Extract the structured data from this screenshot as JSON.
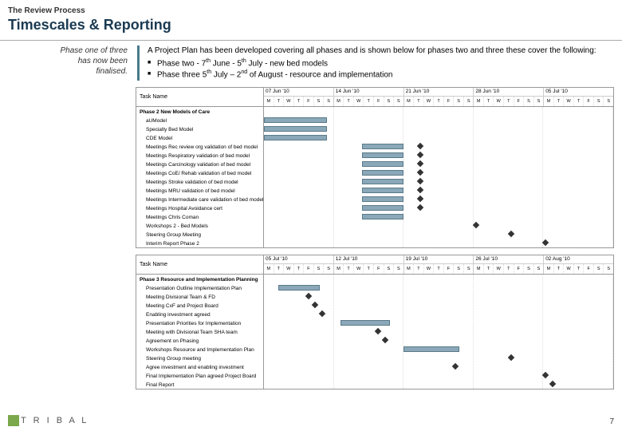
{
  "header": {
    "review_process": "The Review Process",
    "title": "Timescales & Reporting"
  },
  "phase_note": {
    "line1": "Phase one of three",
    "line2": "has now been",
    "line3": "finalised."
  },
  "intro": {
    "lead": "A Project Plan has been developed covering all phases and is shown below for phases two and three these cover the following:",
    "bullet1_a": "Phase two - 7",
    "bullet1_b": " June - 5",
    "bullet1_c": " July - new bed models",
    "bullet2_a": "Phase three 5",
    "bullet2_b": " July – 2",
    "bullet2_c": " of August - resource and implementation",
    "th": "th",
    "nd": "nd"
  },
  "gantt1": {
    "task_header": "Task Name",
    "weeks": [
      "07 Jun '10",
      "14 Jun '10",
      "21 Jun '10",
      "28 Jun '10",
      "05 Jul '10"
    ],
    "days": [
      "M",
      "T",
      "W",
      "T",
      "F",
      "S",
      "S"
    ],
    "rows": [
      {
        "label": "Phase 2 New Models of Care",
        "bold": true,
        "indent": false
      },
      {
        "label": "aUModel",
        "indent": true
      },
      {
        "label": "Specialty Bed Model",
        "indent": true
      },
      {
        "label": "CDE Model",
        "indent": true
      },
      {
        "label": "Meetings Rec review org validation of bed model",
        "indent": true
      },
      {
        "label": "Meetings Respiratory validation of bed model",
        "indent": true
      },
      {
        "label": "Meetings Carcinology validation of bed model",
        "indent": true
      },
      {
        "label": "Meetings CoE/ Rehab validation of bed model",
        "indent": true
      },
      {
        "label": "Meetings Stroke validation of bed model",
        "indent": true
      },
      {
        "label": "Meetings MRU validation of bed model",
        "indent": true
      },
      {
        "label": "Meetings Intermediate care validation of bed model",
        "indent": true
      },
      {
        "label": "Meetings Hospital Avoidance cert",
        "indent": true
      },
      {
        "label": "Meetings Chris Coman",
        "indent": true
      },
      {
        "label": "Workshops 2 - Bed Models",
        "indent": true
      },
      {
        "label": "Steering Group Meeting",
        "indent": true
      },
      {
        "label": "Interim Report Phase 2",
        "indent": true
      }
    ]
  },
  "gantt2": {
    "task_header": "Task Name",
    "weeks": [
      "05 Jul '10",
      "12 Jul '10",
      "19 Jul '10",
      "26 Jul '10",
      "02 Aug '10"
    ],
    "days": [
      "M",
      "T",
      "W",
      "T",
      "F",
      "S",
      "S"
    ],
    "rows": [
      {
        "label": "Phase 3 Resource and Implementation Planning",
        "bold": true
      },
      {
        "label": "Presentation Outline Implementation Plan",
        "indent": true
      },
      {
        "label": "Meeting Divisional Team & FD",
        "indent": true
      },
      {
        "label": "Meeting CxF and Project Board",
        "indent": true
      },
      {
        "label": "Enabling investment agreed",
        "indent": true
      },
      {
        "label": "Presentation Priorities for Implementation",
        "indent": true
      },
      {
        "label": "Meeting with Divisional Team SHA team",
        "indent": true
      },
      {
        "label": "Agreement on Phasing",
        "indent": true
      },
      {
        "label": "Workshops Resource and Implementation Plan",
        "indent": true
      },
      {
        "label": "Steering Group meeting",
        "indent": true
      },
      {
        "label": "Agree investment and enabling investment",
        "indent": true
      },
      {
        "label": "Final Implementation Plan agreed Project Board",
        "indent": true
      },
      {
        "label": "Final Report",
        "indent": true
      }
    ]
  },
  "chart_data": [
    {
      "type": "gantt",
      "title": "Phase 2 New Models of Care",
      "xrange": [
        "2010-06-07",
        "2010-07-11"
      ],
      "tasks": [
        {
          "name": "aUModel",
          "start_pct": 0,
          "width_pct": 18
        },
        {
          "name": "Specialty Bed Model",
          "start_pct": 0,
          "width_pct": 18
        },
        {
          "name": "CDE Model",
          "start_pct": 0,
          "width_pct": 18
        },
        {
          "name": "Meetings Rec review org validation of bed model",
          "start_pct": 28,
          "width_pct": 12,
          "milestone_pct": 44
        },
        {
          "name": "Meetings Respiratory validation of bed model",
          "start_pct": 28,
          "width_pct": 12,
          "milestone_pct": 44
        },
        {
          "name": "Meetings Carcinology validation of bed model",
          "start_pct": 28,
          "width_pct": 12,
          "milestone_pct": 44
        },
        {
          "name": "Meetings CoE/ Rehab validation of bed model",
          "start_pct": 28,
          "width_pct": 12,
          "milestone_pct": 44
        },
        {
          "name": "Meetings Stroke validation of bed model",
          "start_pct": 28,
          "width_pct": 12,
          "milestone_pct": 44
        },
        {
          "name": "Meetings MRU validation of bed model",
          "start_pct": 28,
          "width_pct": 12,
          "milestone_pct": 44
        },
        {
          "name": "Meetings Intermediate care validation of bed model",
          "start_pct": 28,
          "width_pct": 12,
          "milestone_pct": 44
        },
        {
          "name": "Meetings Hospital Avoidance cert",
          "start_pct": 28,
          "width_pct": 12,
          "milestone_pct": 44
        },
        {
          "name": "Meetings Chris Coman",
          "start_pct": 28,
          "width_pct": 12
        },
        {
          "name": "Workshops 2 - Bed Models",
          "milestone_pct": 60
        },
        {
          "name": "Steering Group Meeting",
          "milestone_pct": 70
        },
        {
          "name": "Interim Report Phase 2",
          "milestone_pct": 80
        }
      ]
    },
    {
      "type": "gantt",
      "title": "Phase 3 Resource and Implementation Planning",
      "xrange": [
        "2010-07-05",
        "2010-08-08"
      ],
      "tasks": [
        {
          "name": "Presentation Outline Implementation Plan",
          "start_pct": 4,
          "width_pct": 12
        },
        {
          "name": "Meeting Divisional Team & FD",
          "milestone_pct": 12
        },
        {
          "name": "Meeting CxF and Project Board",
          "milestone_pct": 14
        },
        {
          "name": "Enabling investment agreed",
          "milestone_pct": 16
        },
        {
          "name": "Presentation Priorities for Implementation",
          "start_pct": 22,
          "width_pct": 14
        },
        {
          "name": "Meeting with Divisional Team SHA team",
          "milestone_pct": 32
        },
        {
          "name": "Agreement on Phasing",
          "milestone_pct": 34
        },
        {
          "name": "Workshops Resource and Implementation Plan",
          "start_pct": 40,
          "width_pct": 16
        },
        {
          "name": "Steering Group meeting",
          "milestone_pct": 70
        },
        {
          "name": "Agree investment and enabling investment",
          "milestone_pct": 54
        },
        {
          "name": "Final Implementation Plan agreed Project Board",
          "milestone_pct": 80
        },
        {
          "name": "Final Report",
          "milestone_pct": 82
        }
      ]
    }
  ],
  "footer": {
    "logo": "T R I B A L",
    "page": "7"
  }
}
